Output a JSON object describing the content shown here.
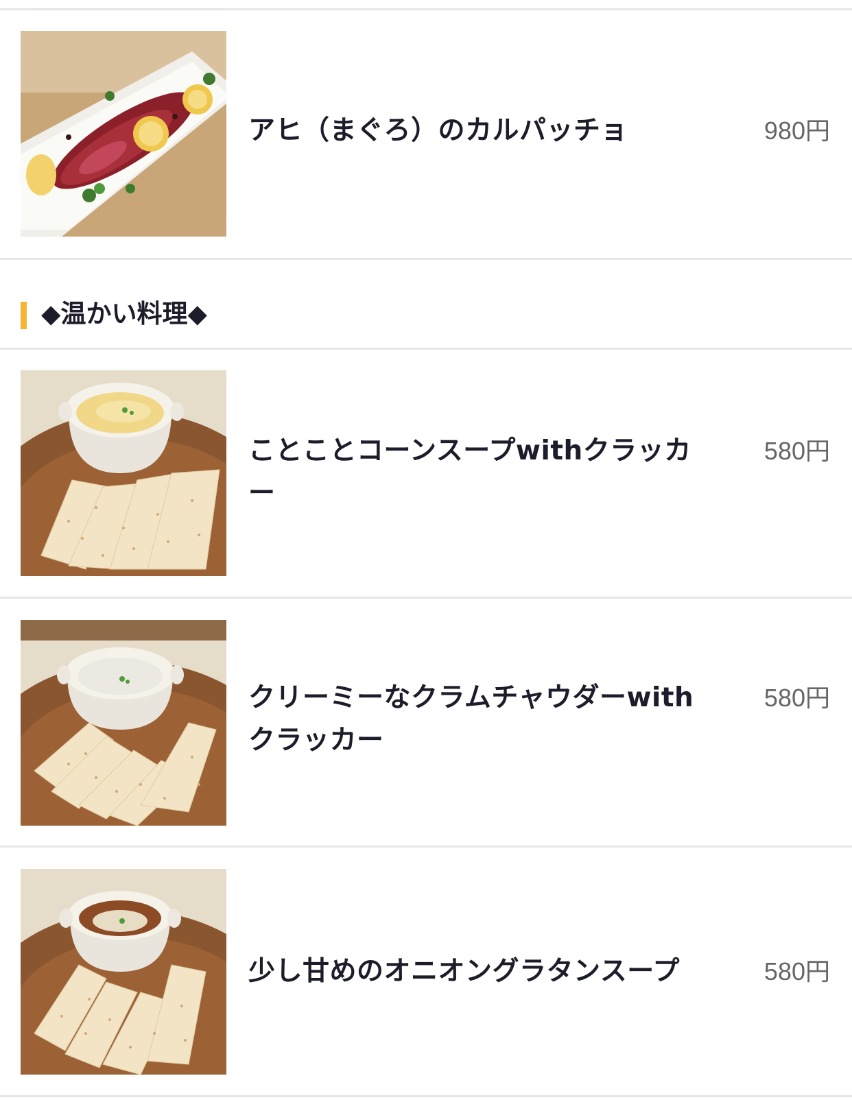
{
  "section": {
    "title": "◆温かい料理◆",
    "accent_color": "#f5b433"
  },
  "items": [
    {
      "name": "アヒ（まぐろ）のカルパッチョ",
      "price": "980円",
      "photo": "tuna-carpaccio-photo"
    },
    {
      "name": "ことことコーンスープwithクラッカー",
      "price": "580円",
      "photo": "corn-soup-photo"
    },
    {
      "name": "クリーミーなクラムチャウダーwithクラッカー",
      "price": "580円",
      "photo": "clam-chowder-photo"
    },
    {
      "name": "少し甘めのオニオングラタンスープ",
      "price": "580円",
      "photo": "onion-gratin-soup-photo"
    }
  ]
}
